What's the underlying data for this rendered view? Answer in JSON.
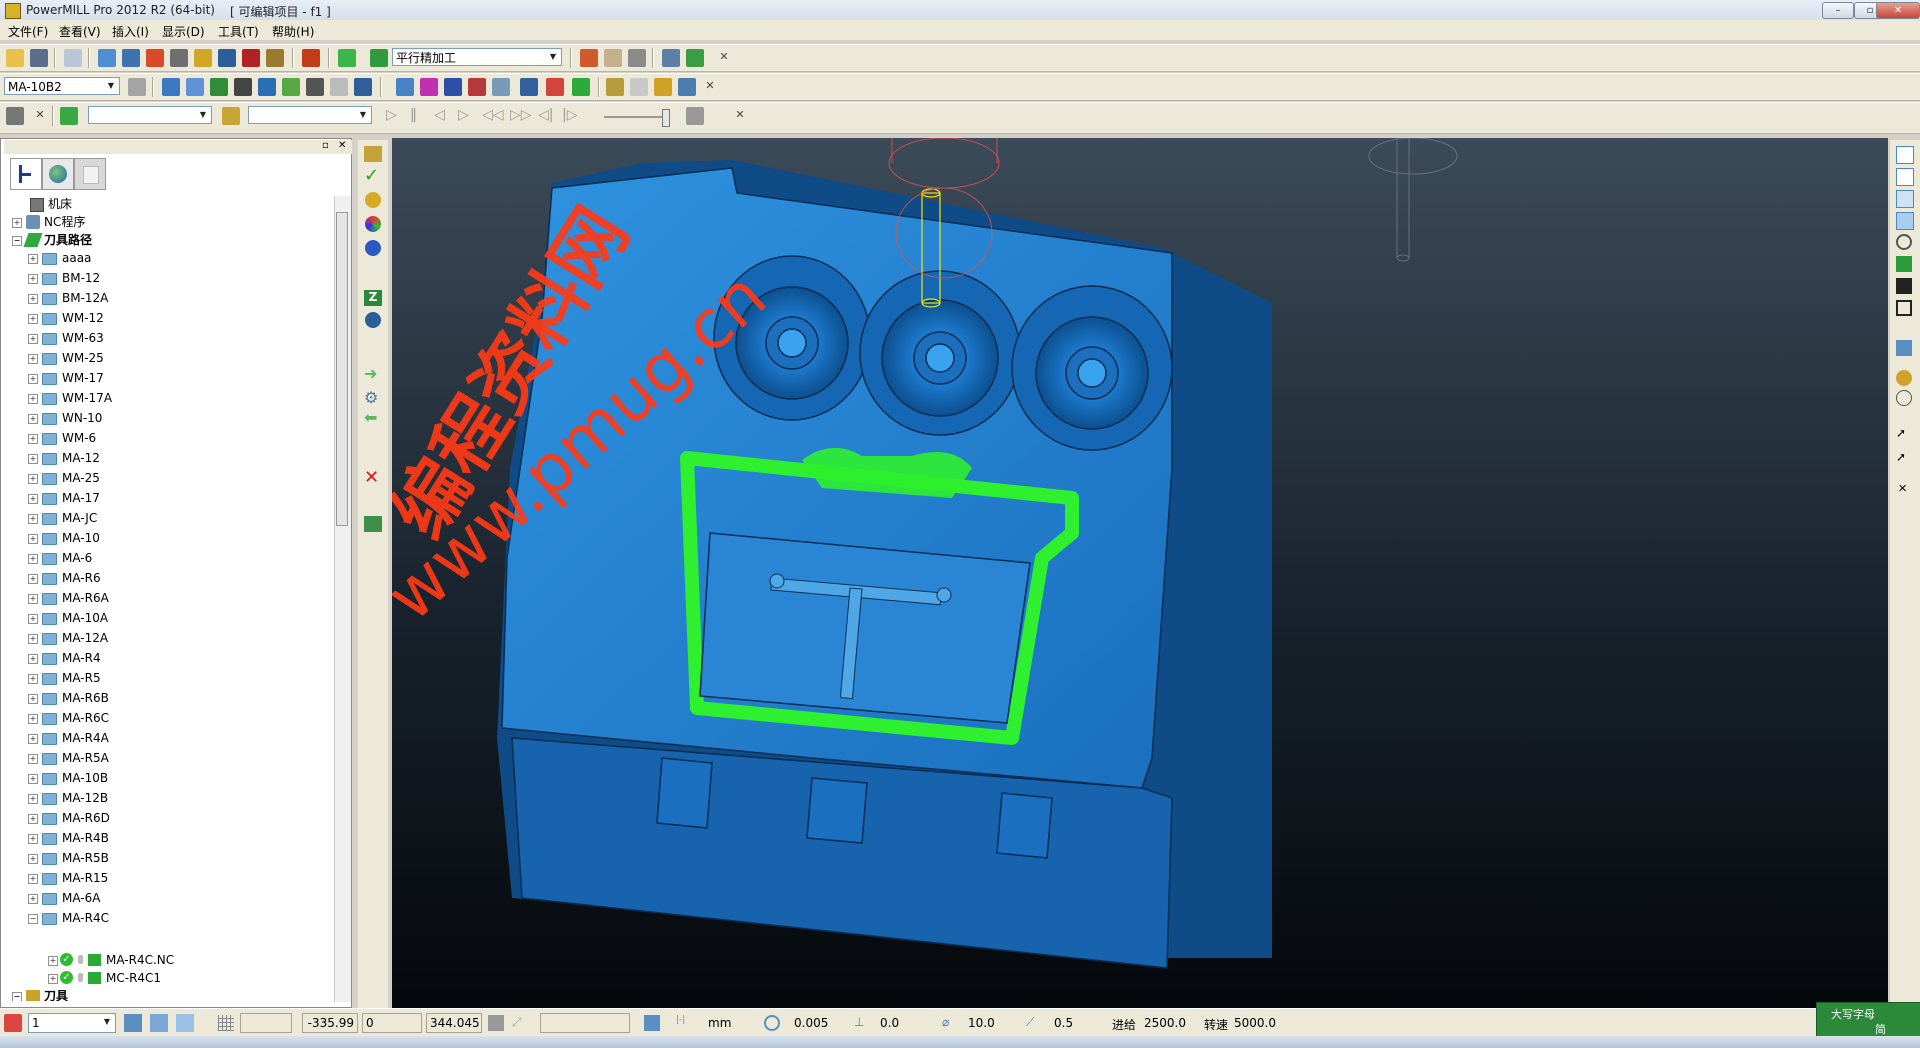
{
  "app": {
    "title": "PowerMILL Pro 2012 R2 (64-bit)",
    "project": "[ 可编辑项目 - f1 ]",
    "window_buttons": [
      "–",
      "▫",
      "✕"
    ]
  },
  "menu": [
    "文件(F)",
    "查看(V)",
    "插入(I)",
    "显示(D)",
    "工具(T)",
    "帮助(H)"
  ],
  "toolbar1": {
    "strategy_combo": "平行精加工"
  },
  "toolbar2": {
    "tool_combo": "MA-10B2"
  },
  "toolbar3": {
    "combo1": "",
    "combo2": ""
  },
  "tree": {
    "machine": "机床",
    "nc_programs": "NC程序",
    "toolpaths": "刀具路径",
    "items": [
      "aaaa",
      "BM-12",
      "BM-12A",
      "WM-12",
      "WM-63",
      "WM-25",
      "WM-17",
      "WM-17A",
      "WN-10",
      "WM-6",
      "MA-12",
      "MA-25",
      "MA-17",
      "MA-JC",
      "MA-10",
      "MA-6",
      "MA-R6",
      "MA-R6A",
      "MA-10A",
      "MA-12A",
      "MA-R4",
      "MA-R5",
      "MA-R6B",
      "MA-R6C",
      "MA-R4A",
      "MA-R5A",
      "MA-10B",
      "MA-12B",
      "MA-R6D",
      "MA-R4B",
      "MA-R5B",
      "MA-R15",
      "MA-6A",
      "MA-R4C"
    ],
    "expanded_children": [
      "MA-R4C.NC",
      "MC-R4C1"
    ],
    "tools": "刀具"
  },
  "status": {
    "workplane": "1",
    "x": "-335.99",
    "y": "0",
    "z": "344.045",
    "units": "mm",
    "tolerance": "0.005",
    "thickness": "0.0",
    "diameter": "10.0",
    "stepover": "0.5",
    "feed_label": "进给",
    "feed": "2500.0",
    "speed_label": "转速",
    "speed": "5000.0"
  },
  "ime": {
    "caps": "大写字母",
    "short": "简"
  },
  "watermark": {
    "cn": "编程资料网",
    "url": "www.pmug.cn"
  },
  "colors": {
    "model": "#1e78c8",
    "toolpath": "#2ef02e",
    "watermark": "#ff3a16"
  },
  "icons": [
    "open-icon",
    "save-icon",
    "print-icon",
    "block-icon",
    "tool-icon",
    "feed-icon",
    "zoom-icon",
    "play-icon",
    "pause-icon",
    "stop-icon"
  ]
}
